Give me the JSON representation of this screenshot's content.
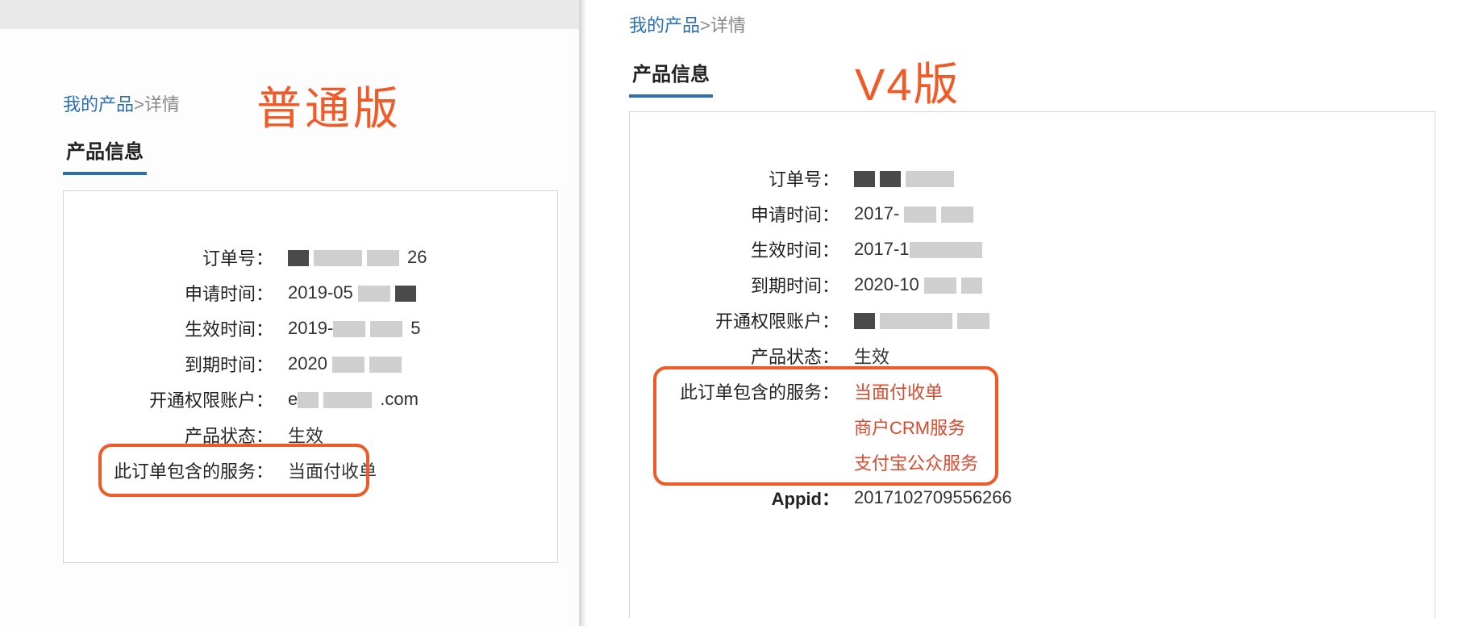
{
  "left": {
    "annotation": "普通版",
    "breadcrumb": {
      "link": "我的产品",
      "sep": ">",
      "current": "详情"
    },
    "section_tab": "产品信息",
    "rows": {
      "order_no": {
        "label": "订单号：",
        "val_tail": "26"
      },
      "apply_time": {
        "label": "申请时间：",
        "val_prefix": "2019-05"
      },
      "effective_time": {
        "label": "生效时间：",
        "val_prefix": "2019-",
        "val_tail": "5"
      },
      "expire_time": {
        "label": "到期时间：",
        "val_prefix": "2020"
      },
      "account": {
        "label": "开通权限账户：",
        "val_prefix": "e",
        "val_tail": ".com"
      },
      "status": {
        "label": "产品状态：",
        "val": "生效"
      },
      "services": {
        "label": "此订单包含的服务：",
        "val": "当面付收单"
      }
    }
  },
  "right": {
    "annotation": "V4版",
    "breadcrumb": {
      "link": "我的产品",
      "sep": ">",
      "current": "详情"
    },
    "section_tab": "产品信息",
    "rows": {
      "order_no": {
        "label": "订单号："
      },
      "apply_time": {
        "label": "申请时间：",
        "val_prefix": "2017-"
      },
      "effective_time": {
        "label": "生效时间：",
        "val_prefix": "2017-1"
      },
      "expire_time": {
        "label": "到期时间：",
        "val_prefix": "2020-10"
      },
      "account": {
        "label": "开通权限账户："
      },
      "status": {
        "label": "产品状态：",
        "val": "生效"
      },
      "services": {
        "label": "此订单包含的服务：",
        "vals": [
          "当面付收单",
          "商户CRM服务",
          "支付宝公众服务"
        ]
      },
      "appid": {
        "label": "Appid：",
        "val": "2017102709556266"
      }
    }
  }
}
